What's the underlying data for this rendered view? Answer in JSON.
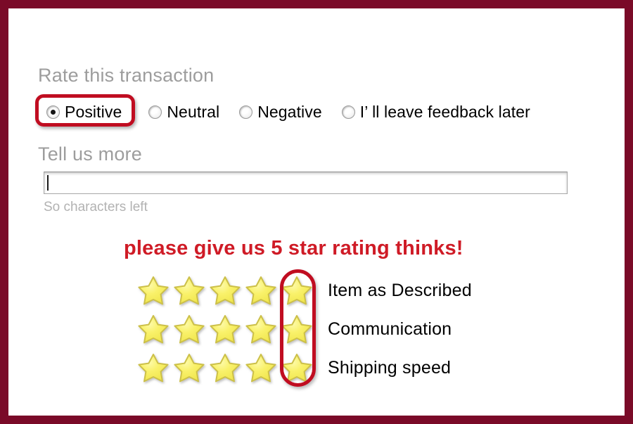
{
  "frame": {
    "border_color": "#7a0a28",
    "background": "#ffffff"
  },
  "rate_section": {
    "heading": "Rate this transaction",
    "options": [
      {
        "label": "Positive",
        "selected": true,
        "highlighted": true
      },
      {
        "label": "Neutral",
        "selected": false,
        "highlighted": false
      },
      {
        "label": "Negative",
        "selected": false,
        "highlighted": false
      },
      {
        "label": "I’ ll leave feedback later",
        "selected": false,
        "highlighted": false
      }
    ]
  },
  "comment_section": {
    "heading": "Tell us more",
    "input_value": "",
    "input_placeholder": "",
    "characters_left": "So characters left"
  },
  "appeal": {
    "text": "please give us 5 star rating thinks!",
    "color": "#cf1b26"
  },
  "star_ratings": {
    "max_stars": 5,
    "highlight_column": 5,
    "highlight_color": "#c00d21",
    "star_fill": "#f7ef5a",
    "star_outline": "#cfc24a",
    "rows": [
      {
        "label": "Item as Described",
        "value": 5
      },
      {
        "label": "Communication",
        "value": 5
      },
      {
        "label": "Shipping speed",
        "value": 5
      }
    ]
  },
  "icons": {
    "star": "star-icon",
    "radio_selected": "radio-selected-icon",
    "radio_unselected": "radio-unselected-icon",
    "caret": "text-caret-icon"
  }
}
